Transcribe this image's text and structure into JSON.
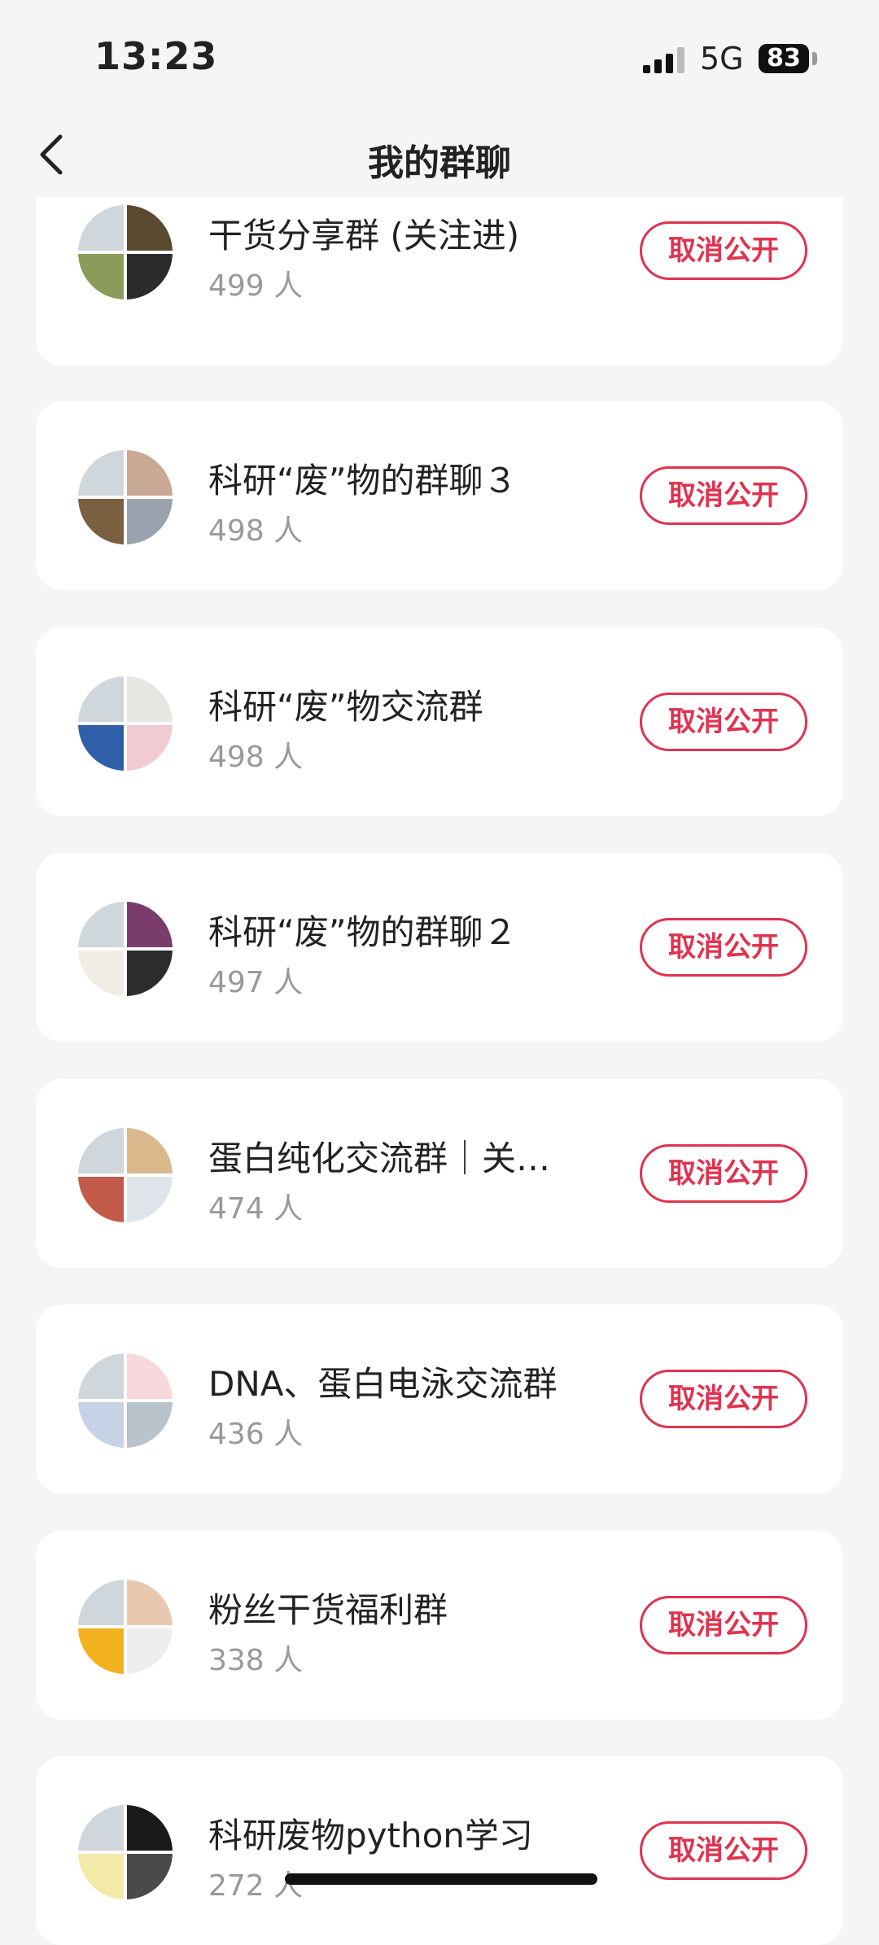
{
  "status": {
    "time": "13:23",
    "network": "5G",
    "battery": "83"
  },
  "header": {
    "title": "我的群聊"
  },
  "groups": [
    {
      "name": "干货分享群 (关注进)",
      "members": "499 人",
      "action": "取消公开",
      "colors": [
        "#cfd6dc",
        "#5a4a30",
        "#8a9b5a",
        "#2b2b2b"
      ]
    },
    {
      "name": "科研“废”物的群聊３",
      "members": "498 人",
      "action": "取消公开",
      "colors": [
        "#cfd6dc",
        "#c9a894",
        "#7a6040",
        "#9aa3ad"
      ]
    },
    {
      "name": "科研“废”物交流群",
      "members": "498 人",
      "action": "取消公开",
      "colors": [
        "#cfd6dc",
        "#e8e6e2",
        "#2f5fa8",
        "#f1cbd2"
      ]
    },
    {
      "name": "科研“废”物的群聊２",
      "members": "497 人",
      "action": "取消公开",
      "colors": [
        "#cfd6dc",
        "#7a3c6a",
        "#f2ede4",
        "#2c2c2c"
      ]
    },
    {
      "name": "蛋白纯化交流群｜关…",
      "members": "474 人",
      "action": "取消公开",
      "colors": [
        "#cfd6dc",
        "#d9b98c",
        "#c25a4a",
        "#dfe4ea"
      ]
    },
    {
      "name": "DNA、蛋白电泳交流群",
      "members": "436 人",
      "action": "取消公开",
      "colors": [
        "#cfd6dc",
        "#f7d8dc",
        "#c8d2e6",
        "#b9c3cc"
      ]
    },
    {
      "name": "粉丝干货福利群",
      "members": "338 人",
      "action": "取消公开",
      "colors": [
        "#cfd6dc",
        "#e8c9b0",
        "#f2b21f",
        "#eeeeee"
      ]
    },
    {
      "name": "科研废物python学习",
      "members": "272 人",
      "action": "取消公开",
      "colors": [
        "#cfd6dc",
        "#1a1a1a",
        "#f3e9a8",
        "#4a4a4a"
      ]
    }
  ]
}
